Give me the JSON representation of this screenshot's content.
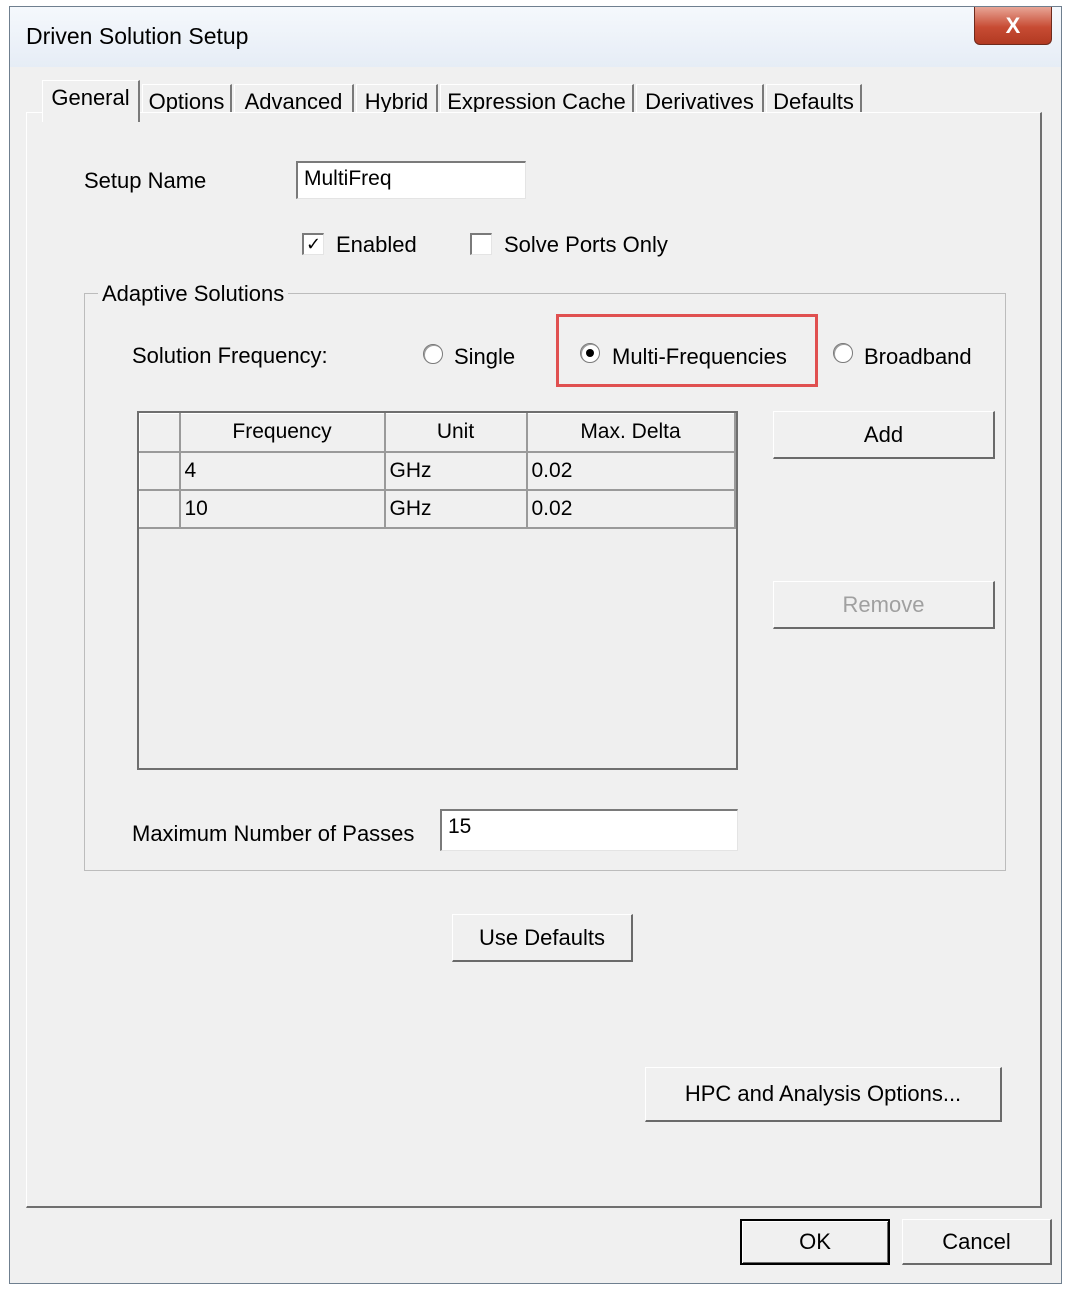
{
  "window": {
    "title": "Driven Solution Setup",
    "close_glyph": "X"
  },
  "tabs": [
    {
      "label": "General",
      "active": true
    },
    {
      "label": "Options"
    },
    {
      "label": "Advanced"
    },
    {
      "label": "Hybrid"
    },
    {
      "label": "Expression Cache"
    },
    {
      "label": "Derivatives"
    },
    {
      "label": "Defaults"
    }
  ],
  "setup": {
    "name_label": "Setup Name",
    "name_value": "MultiFreq"
  },
  "checks": {
    "enabled_label": "Enabled",
    "enabled_checked": true,
    "solve_ports_label": "Solve Ports Only",
    "solve_ports_checked": false,
    "check_glyph": "✓"
  },
  "adaptive": {
    "group_title": "Adaptive Solutions",
    "freq_label": "Solution Frequency:",
    "options": [
      {
        "label": "Single",
        "selected": false
      },
      {
        "label": "Multi-Frequencies",
        "selected": true
      },
      {
        "label": "Broadband",
        "selected": false
      }
    ],
    "highlight_color": "#e05050",
    "table": {
      "headers": [
        "Frequency",
        "Unit",
        "Max. Delta"
      ],
      "rows": [
        [
          "4",
          "GHz",
          "0.02"
        ],
        [
          "10",
          "GHz",
          "0.02"
        ]
      ]
    },
    "add_label": "Add",
    "remove_label": "Remove",
    "passes_label": "Maximum Number of Passes",
    "passes_value": "15"
  },
  "buttons": {
    "use_defaults": "Use Defaults",
    "hpc": "HPC and Analysis Options...",
    "ok": "OK",
    "cancel": "Cancel"
  }
}
